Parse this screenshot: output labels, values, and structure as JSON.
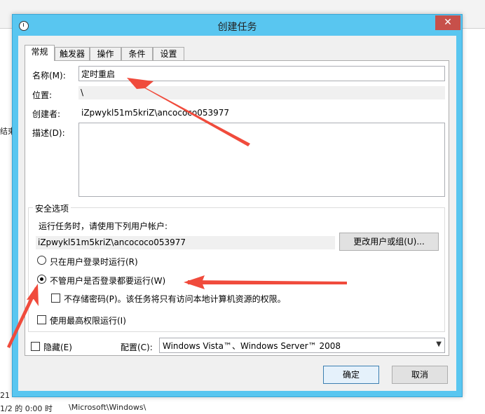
{
  "background": {
    "left_snippet_1": "结束",
    "row_a": "21",
    "row_b": "1/2 的 0:00 时",
    "row_b_path": "\\Microsoft\\Windows\\"
  },
  "dialog": {
    "title": "创建任务",
    "close_symbol": "✕"
  },
  "tabs": [
    "常规",
    "触发器",
    "操作",
    "条件",
    "设置"
  ],
  "general": {
    "name_label": "名称(M):",
    "name_value": "定时重启",
    "location_label": "位置:",
    "location_value": "\\",
    "author_label": "创建者:",
    "author_value": "iZpwykl51m5kriZ\\ancococo053977",
    "description_label": "描述(D):",
    "description_value": ""
  },
  "security": {
    "group_title": "安全选项",
    "run_as_label": "运行任务时，请使用下列用户帐户:",
    "run_as_user": "iZpwykl51m5kriZ\\ancococo053977",
    "change_user_button": "更改用户或组(U)...",
    "radio_logged_on": "只在用户登录时运行(R)",
    "radio_whether": "不管用户是否登录都要运行(W)",
    "do_not_store_password": "不存储密码(P)。该任务将只有访问本地计算机资源的权限。",
    "run_highest": "使用最高权限运行(I)",
    "selected_radio": "radio_whether"
  },
  "footer": {
    "hidden_label": "隐藏(E)",
    "configure_label": "配置(C):",
    "configure_value": "Windows Vista™、Windows Server™ 2008",
    "ok_button": "确定",
    "cancel_button": "取消"
  },
  "colors": {
    "title_bar": "#59c6f0",
    "close_button": "#c7504a",
    "annotation_arrow": "#f04b3c"
  }
}
